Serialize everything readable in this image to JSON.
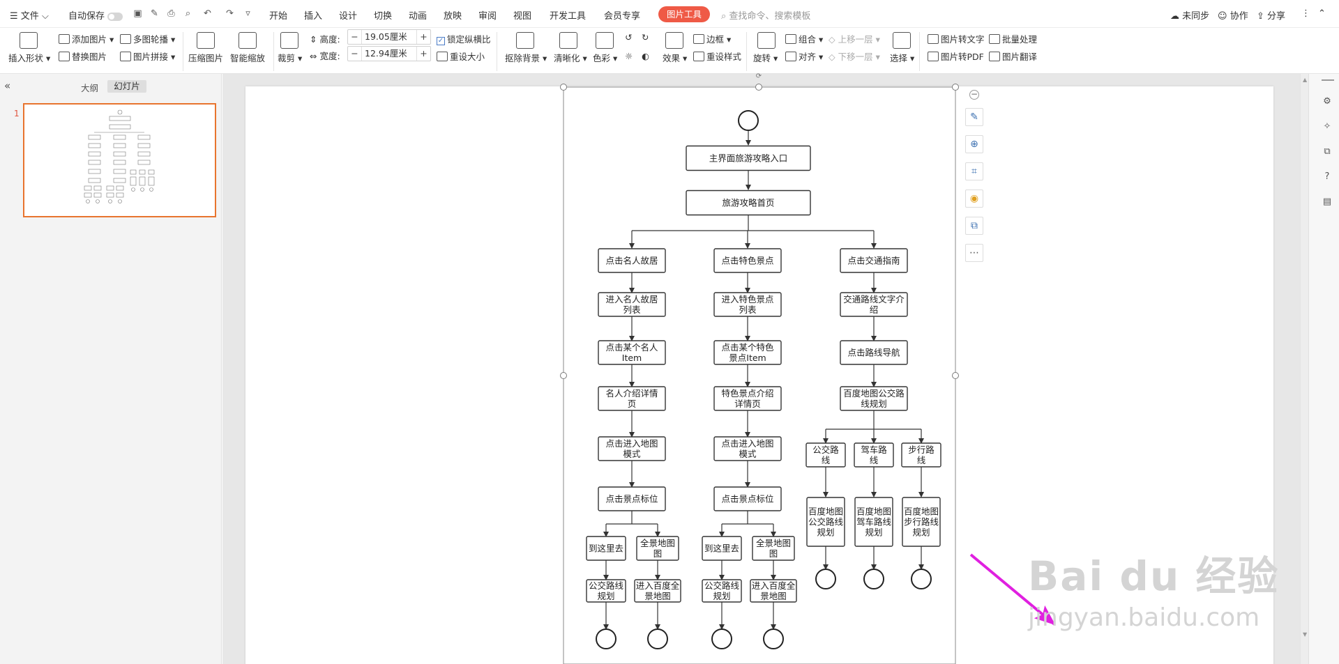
{
  "menubar": {
    "file": "文件",
    "autosave": "自动保存",
    "tabs": [
      "开始",
      "插入",
      "设计",
      "切换",
      "动画",
      "放映",
      "审阅",
      "视图",
      "开发工具",
      "会员专享"
    ],
    "picture_tools": "图片工具",
    "search_placeholder": "查找命令、搜索模板",
    "sync": "未同步",
    "collab": "协作",
    "share": "分享"
  },
  "ribbon": {
    "insert_shape": "插入形状",
    "add_picture": "添加图片",
    "replace_picture": "替换图片",
    "multi_carousel": "多图轮播",
    "picture_splice": "图片拼接",
    "compress": "压缩图片",
    "smart_zoom": "智能缩放",
    "crop": "裁剪",
    "height_label": "高度:",
    "height_value": "19.05厘米",
    "width_label": "宽度:",
    "width_value": "12.94厘米",
    "lock_ratio": "锁定纵横比",
    "reset_size": "重设大小",
    "remove_bg": "抠除背景",
    "sharpen": "清晰化",
    "color": "色彩",
    "effects": "效果",
    "reset_style": "重设样式",
    "border": "边框",
    "rotate": "旋转",
    "group": "组合",
    "align": "对齐",
    "bring_forward": "上移一层",
    "send_backward": "下移一层",
    "select": "选择",
    "pic_to_text": "图片转文字",
    "batch": "批量处理",
    "pic_to_pdf": "图片转PDF",
    "pic_translate": "图片翻译"
  },
  "panel": {
    "outline_tab": "大纲",
    "slides_tab": "幻灯片",
    "slide_number": "1"
  },
  "flowchart": {
    "entry": "主界面旅游攻略入口",
    "home": "旅游攻略首页",
    "col1": [
      "点击名人故居",
      "进入名人故居列表",
      "点击某个名人Item",
      "名人介绍详情页",
      "点击进入地图模式",
      "点击景点标位"
    ],
    "col1_leaves": [
      "到这里去",
      "全景地图图",
      "公交路线规划",
      "进入百度全景地图"
    ],
    "col2": [
      "点击特色景点",
      "进入特色景点列表",
      "点击某个特色景点Item",
      "特色景点介绍详情页",
      "点击进入地图模式",
      "点击景点标位"
    ],
    "col2_leaves": [
      "到这里去",
      "全景地图图",
      "公交路线规划",
      "进入百度全景地图"
    ],
    "col3": [
      "点击交通指南",
      "交通路线文字介绍",
      "点击路线导航",
      "百度地图公交路线规划"
    ],
    "col3_leaves": [
      "公交路线",
      "驾车路线",
      "步行路线"
    ],
    "col3_maps": [
      "百度地图公交路线规划",
      "百度地图驾车路线规划",
      "百度地图步行路线规划"
    ]
  },
  "watermark": {
    "brand": "Bai du 经验",
    "url": "jingyan.baidu.com"
  },
  "colors": {
    "accent": "#ef5a46",
    "arrow": "#e020e0"
  }
}
